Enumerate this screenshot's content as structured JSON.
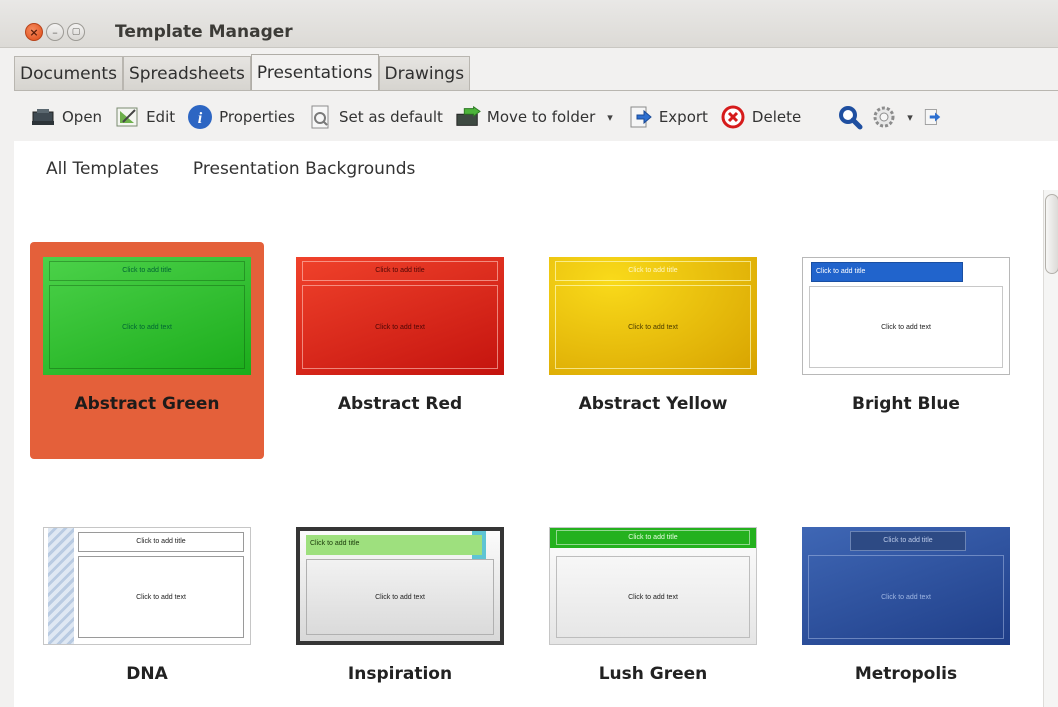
{
  "window": {
    "title": "Template Manager"
  },
  "tabs": [
    {
      "label": "Documents"
    },
    {
      "label": "Spreadsheets"
    },
    {
      "label": "Presentations",
      "active": true
    },
    {
      "label": "Drawings"
    }
  ],
  "toolbar": {
    "open": "Open",
    "edit": "Edit",
    "properties": "Properties",
    "set_default": "Set as default",
    "move_to_folder": "Move to folder",
    "export": "Export",
    "delete": "Delete"
  },
  "breadcrumbs": [
    "All Templates",
    "Presentation Backgrounds"
  ],
  "templates": [
    {
      "name": "Abstract Green",
      "title_ph": "Click to add title",
      "text_ph": "Click to add text",
      "selected": true
    },
    {
      "name": "Abstract Red",
      "title_ph": "Click to add title",
      "text_ph": "Click to add text"
    },
    {
      "name": "Abstract Yellow",
      "title_ph": "Click to add title",
      "text_ph": "Click to add text"
    },
    {
      "name": "Bright Blue",
      "title_ph": "Click to add title",
      "text_ph": "Click to add text"
    },
    {
      "name": "DNA",
      "title_ph": "Click to add title",
      "text_ph": "Click to add text"
    },
    {
      "name": "Inspiration",
      "title_ph": "Click to add title",
      "text_ph": "Click to add text"
    },
    {
      "name": "Lush Green",
      "title_ph": "Click to add title",
      "text_ph": "Click to add text"
    },
    {
      "name": "Metropolis",
      "title_ph": "Click to add title",
      "text_ph": "Click to add text"
    }
  ],
  "colors": {
    "selection": "#e4603a",
    "close_button": "#df4b16"
  }
}
